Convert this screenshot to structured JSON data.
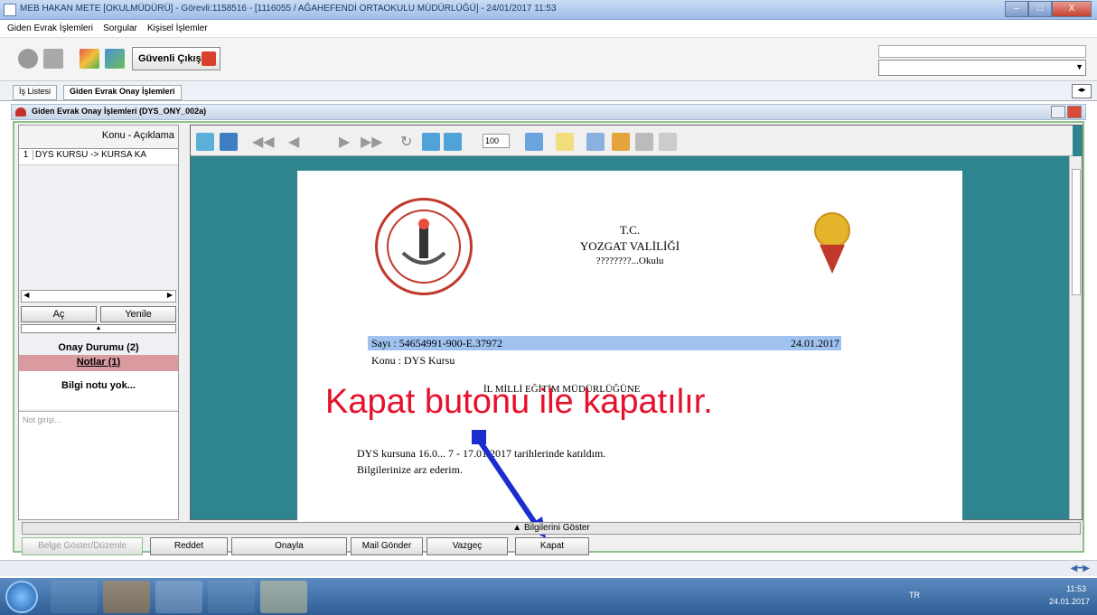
{
  "window": {
    "title": "MEB   HAKAN METE  [OKULMÜDÜRÜ] - Görevli:1158516 - [1116055 / AĞAHEFENDİ ORTAOKULU MÜDÜRLÜĞÜ] - 24/01/2017 11:53",
    "controls": [
      "–",
      "□",
      "X"
    ]
  },
  "menu": [
    "Giden Evrak İşlemleri",
    "Sorgular",
    "Kişisel İşlemler"
  ],
  "toolbar": {
    "secure_exit_label": "Güvenli Çıkış"
  },
  "tabs": [
    {
      "label": "İş Listesi",
      "active": false
    },
    {
      "label": "Giden Evrak Onay İşlemleri",
      "active": true
    }
  ],
  "inner_window": {
    "title": "Giden Evrak Onay İşlemleri (DYS_ONY_002a)"
  },
  "left_panel": {
    "list_header": "Konu - Açıklama",
    "rows": [
      {
        "num": "1",
        "text": "DYS KURSU -> KURSA KA"
      }
    ],
    "open_label": "Aç",
    "refresh_label": "Yenile",
    "approval_status": "Onay Durumu (2)",
    "notes_tab": "Notlar (1)",
    "no_info_text": "Bilgi notu yok...",
    "note_input_placeholder": "Not girişi..."
  },
  "viewer": {
    "zoom": "100"
  },
  "document": {
    "header_line1": "T.C.",
    "header_line2": "YOZGAT VALİLİĞİ",
    "header_line3": "????????...Okulu",
    "sayi": "Sayı   : 54654991-900-E.37972",
    "tarih": "24.01.2017",
    "konu": "Konu : DYS Kursu",
    "mudurluk": "İL MİLLİ EĞİTİM MÜDÜRLÜĞÜNE",
    "body_line1": "DYS kursuna 16.0...  7 - 17.01.2017 tarihlerinde katıldım.",
    "body_line2": "Bilgilerinize arz ederim."
  },
  "annotation": {
    "text": "Kapat butonu ile kapatılır.",
    "color": "#e5102b",
    "arrow_color": "#1a2ecf"
  },
  "bottom": {
    "detail_strip": "Bilgilerini Göster",
    "buttons": [
      "Belge Göster/Düzenle",
      "Reddet",
      "Onayla",
      "Mail Gönder",
      "Vazgeç",
      "Kapat"
    ]
  },
  "taskbar": {
    "language": "TR",
    "time": "11:53",
    "date": "24.01.2017"
  }
}
